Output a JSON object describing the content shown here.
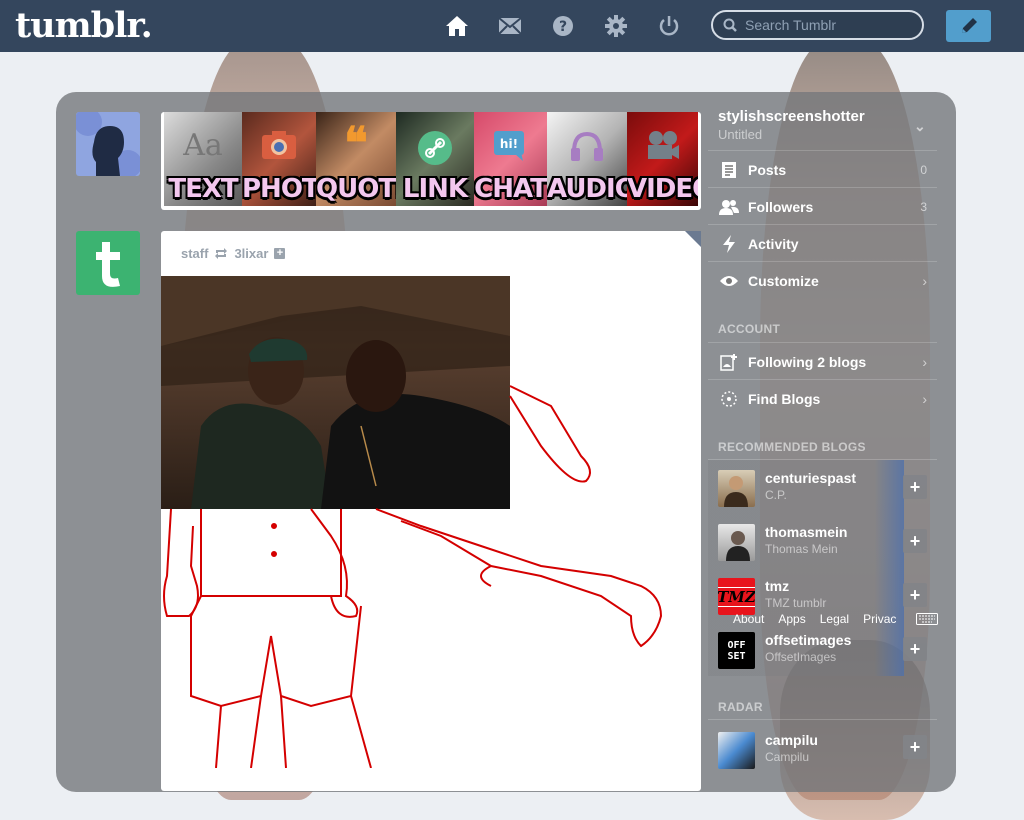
{
  "brand": {
    "logo": "tumblr."
  },
  "nav": {
    "icons": [
      "home-icon",
      "mail-icon",
      "help-icon",
      "settings-icon",
      "power-icon"
    ],
    "search_placeholder": "Search Tumblr"
  },
  "post_types": [
    {
      "label": "TEXT",
      "icon": "text-icon",
      "color": "#e8e8e8"
    },
    {
      "label": "PHOTO",
      "icon": "camera-icon",
      "color": "#d95e40"
    },
    {
      "label": "QUOTE",
      "icon": "quote-icon",
      "color": "#f2992e"
    },
    {
      "label": "LINK",
      "icon": "link-icon",
      "color": "#56bc8a"
    },
    {
      "label": "CHAT",
      "icon": "chat-icon",
      "color": "#529ecc"
    },
    {
      "label": "AUDIO",
      "icon": "headphones-icon",
      "color": "#a77dc2"
    },
    {
      "label": "VIDEO",
      "icon": "video-camera-icon",
      "color": "#748089"
    }
  ],
  "post": {
    "author": "staff",
    "reblogged_from": "3lixar"
  },
  "sidebar": {
    "blog_name": "stylishscreenshotter",
    "blog_title": "Untitled",
    "items": [
      {
        "label": "Posts",
        "count": "0",
        "icon": "posts-icon"
      },
      {
        "label": "Followers",
        "count": "3",
        "icon": "followers-icon"
      },
      {
        "label": "Activity",
        "icon": "activity-icon"
      },
      {
        "label": "Customize",
        "icon": "eye-icon",
        "chevron": "›"
      }
    ],
    "account_heading": "ACCOUNT",
    "account_items": [
      {
        "label": "Following 2 blogs",
        "icon": "following-icon",
        "chevron": "›"
      },
      {
        "label": "Find Blogs",
        "icon": "find-blogs-icon",
        "chevron": "›"
      }
    ],
    "recommended_heading": "RECOMMENDED BLOGS",
    "recommended": [
      {
        "name": "centuriespast",
        "sub": "C.P."
      },
      {
        "name": "thomasmein",
        "sub": "Thomas Mein"
      },
      {
        "name": "tmz",
        "sub": "TMZ tumblr",
        "badge": "TMZ"
      },
      {
        "name": "offsetimages",
        "sub": "OffsetImages",
        "badge": "OFF SET"
      }
    ],
    "radar_heading": "RADAR",
    "radar": {
      "name": "campilu",
      "sub": "Campilu"
    },
    "footer": [
      "About",
      "Apps",
      "Legal",
      "Privac"
    ]
  }
}
